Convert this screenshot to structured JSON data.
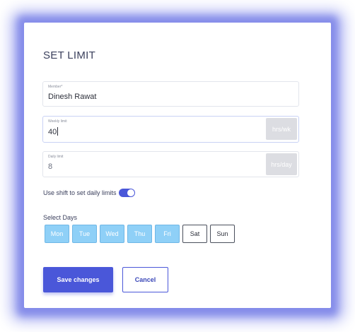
{
  "dialog": {
    "title": "SET LIMIT"
  },
  "member": {
    "label": "Member*",
    "value": "Dinesh Rawat"
  },
  "weekly": {
    "label": "Weekly limit",
    "value": "40",
    "unit": "hrs/wk"
  },
  "daily": {
    "label": "Daily limit",
    "value": "8",
    "unit": "hrs/day"
  },
  "shift_toggle": {
    "label": "Use shift to set daily limits",
    "on": true
  },
  "days": {
    "label": "Select Days",
    "items": [
      {
        "label": "Mon",
        "selected": true
      },
      {
        "label": "Tue",
        "selected": true
      },
      {
        "label": "Wed",
        "selected": true
      },
      {
        "label": "Thu",
        "selected": true
      },
      {
        "label": "Fri",
        "selected": true
      },
      {
        "label": "Sat",
        "selected": false
      },
      {
        "label": "Sun",
        "selected": false
      }
    ]
  },
  "actions": {
    "save_label": "Save changes",
    "cancel_label": "Cancel"
  },
  "colors": {
    "accent": "#4a57d9",
    "day_selected": "#8fd0f7",
    "glow": "#5a63e0"
  }
}
